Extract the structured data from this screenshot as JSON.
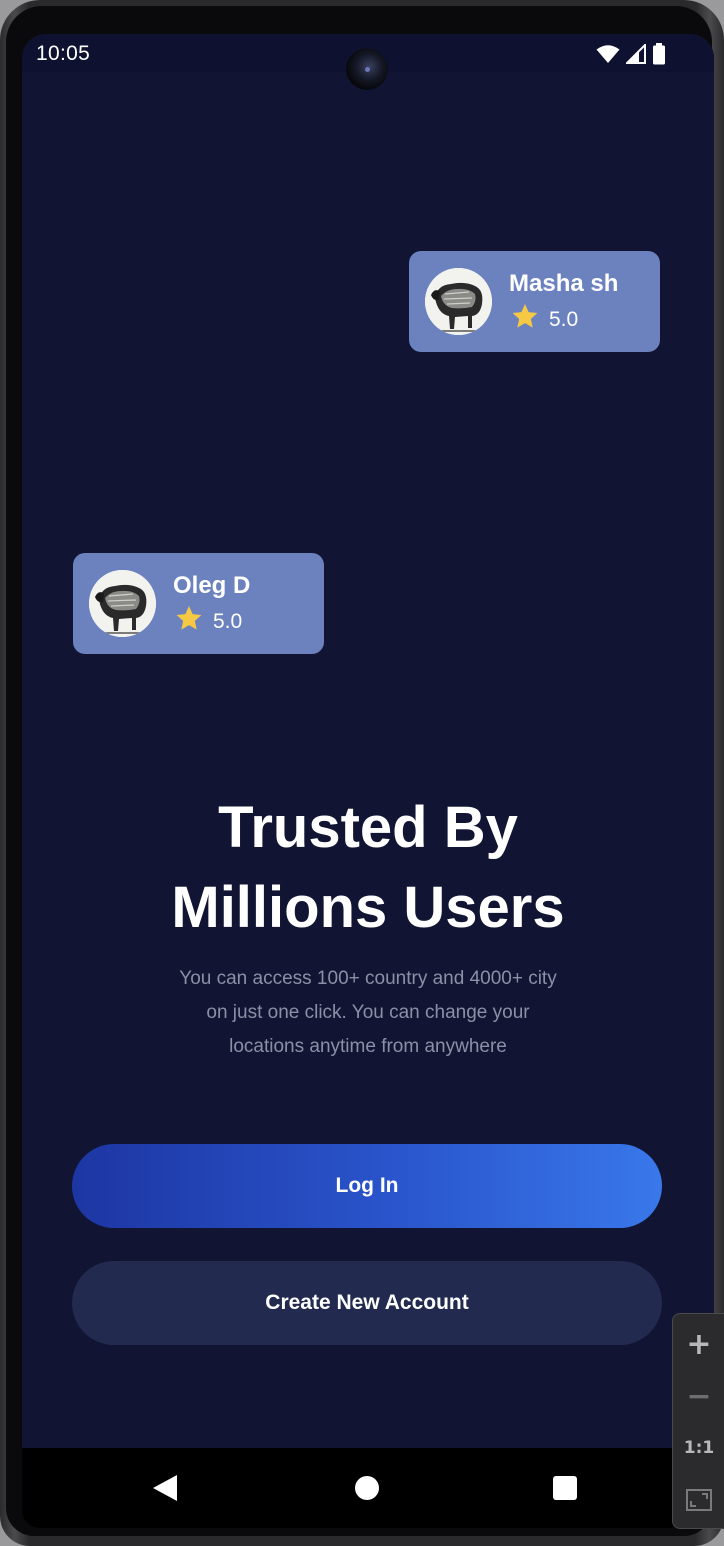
{
  "status_bar": {
    "time": "10:05",
    "icons": [
      "wifi-icon",
      "signal-icon",
      "battery-icon"
    ]
  },
  "reviews": [
    {
      "name": "Masha sh",
      "rating": "5.0",
      "avatar": "bull-illustration"
    },
    {
      "name": "Oleg D",
      "rating": "5.0",
      "avatar": "bull-illustration"
    }
  ],
  "main": {
    "title_line1": "Trusted By",
    "title_line2": "Millions Users",
    "subtitle_line1": "You can access 100+ country and 4000+ city",
    "subtitle_line2": "on just one click. You can change your",
    "subtitle_line3": "locations anytime from anywhere"
  },
  "actions": {
    "login_label": "Log In",
    "create_label": "Create New Account"
  },
  "nav_bar": {
    "icons": [
      "back-icon",
      "home-icon",
      "recents-icon"
    ]
  },
  "zoom_controls": {
    "zoom_in": "+",
    "zoom_out": "−",
    "actual_size": "1:1",
    "icons": [
      "plus-icon",
      "minus-icon",
      "fit-screen-icon"
    ]
  },
  "colors": {
    "background": "#111533",
    "card": "#6b82bf",
    "star": "#f6c945",
    "login_gradient_start": "#1d36a3",
    "login_gradient_end": "#3978ea",
    "create_button": "#222a4f",
    "subtitle_text": "#8c8fa5"
  }
}
